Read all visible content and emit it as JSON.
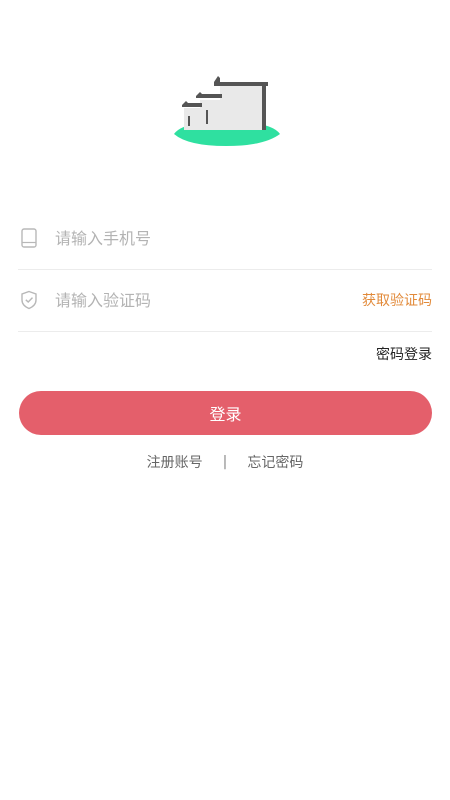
{
  "logo": {
    "icon": "house-on-hill-logo",
    "colors": {
      "roof": "#555555",
      "wall": "#e9e9e9",
      "hill": "#2fe0a0"
    }
  },
  "form": {
    "phone": {
      "icon": "phone-icon",
      "placeholder": "请输入手机号",
      "value": ""
    },
    "code": {
      "icon": "shield-icon",
      "placeholder": "请输入验证码",
      "value": "",
      "get_code_label": "获取验证码"
    }
  },
  "password_login_label": "密码登录",
  "login_button_label": "登录",
  "links": {
    "register": "注册账号",
    "separator": "|",
    "forgot": "忘记密码"
  },
  "colors": {
    "accent": "#e45f6b",
    "link_orange": "#e28a3a"
  }
}
